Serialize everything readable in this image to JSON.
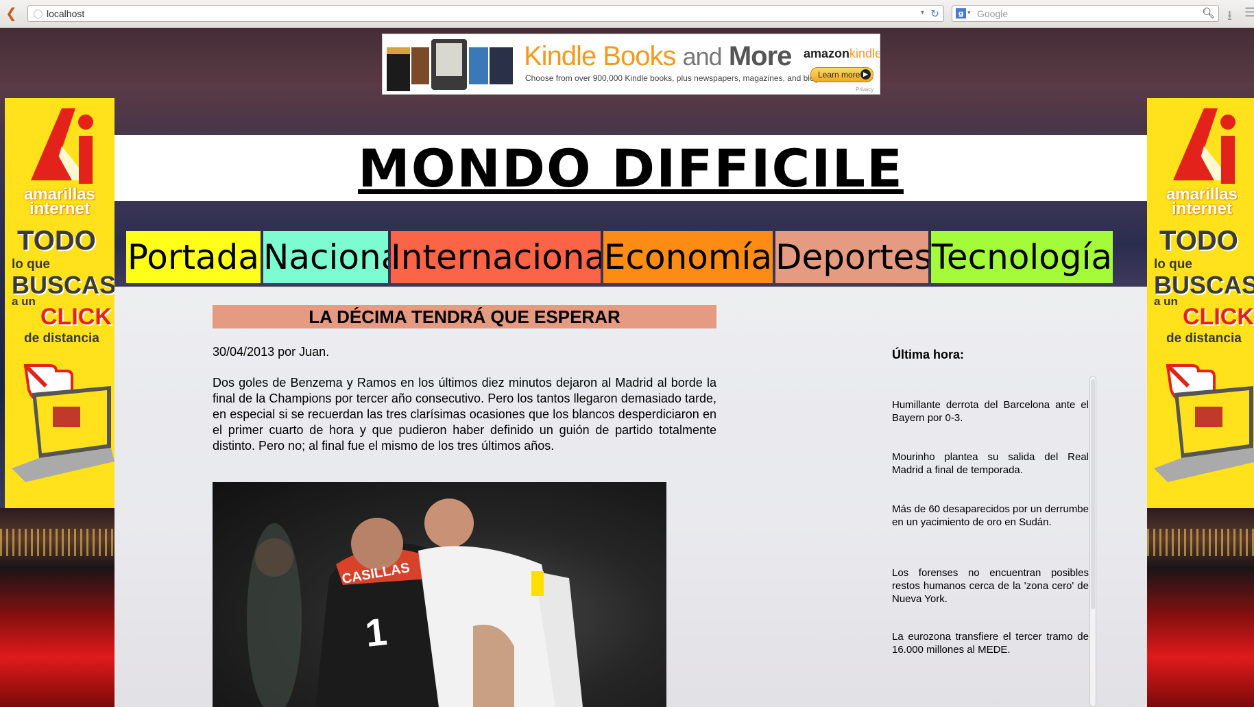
{
  "browser": {
    "url": "localhost",
    "search_placeholder": "Google"
  },
  "kindle_ad": {
    "title_part1": "Kindle Books",
    "title_and": "and",
    "title_part2": "More",
    "subtitle": "Choose from over 900,000 Kindle books, plus newspapers, magazines, and blogs.",
    "brand_amazon": "amazon",
    "brand_kindle": "kindle",
    "button_label": "Learn more",
    "privacy": "Privacy"
  },
  "side_ad": {
    "brand_line1": "amarillas",
    "brand_line2": "internet",
    "line_todo": "TODO",
    "line_lo_que": "lo que",
    "line_buscas": "BUSCAS",
    "line_a_un": "a un",
    "line_click": "CLICK",
    "line_distancia": "de distancia"
  },
  "site": {
    "title": "MONDO DIFFICILE"
  },
  "nav": [
    {
      "label": "Portada",
      "color": "#ffff1a"
    },
    {
      "label": "Nacional",
      "color": "#7dfcd2"
    },
    {
      "label": "Internacional",
      "color": "#fb6446"
    },
    {
      "label": "Economía",
      "color": "#fd8c14"
    },
    {
      "label": "Deportes",
      "color": "#e59b81"
    },
    {
      "label": "Tecnología",
      "color": "#a4fb3a"
    }
  ],
  "article": {
    "title": "LA DÉCIMA TENDRÁ QUE ESPERAR",
    "meta": "30/04/2013 por Juan.",
    "body": "Dos goles de Benzema y Ramos en los últimos diez minutos dejaron al Madrid al borde la final de la Champions por tercer año consecutivo. Pero los tantos llegaron demasiado tarde, en especial si se recuerdan las tres clarísimas ocasiones que los blancos desperdiciaron en el primer cuarto de hora y que pudieron haber definido un guión de partido totalmente distinto. Pero no; al final fue el mismo de los tres últimos años.",
    "photo_shirt_name": "CASILLAS",
    "photo_shirt_number": "1"
  },
  "sidebar": {
    "title": "Última hora:",
    "items": [
      "Humillante derrota del Barcelona ante el Bayern por 0-3.",
      "Mourinho plantea su salida del Real Madrid a final de temporada.",
      "Más de 60 desaparecidos por un derrumbe en un yacimiento de oro en Sudán.",
      "Los forenses no encuentran posibles restos humanos cerca de la 'zona cero' de Nueva York.",
      "La eurozona transfiere el tercer tramo de 16.000 millones al MEDE."
    ]
  }
}
